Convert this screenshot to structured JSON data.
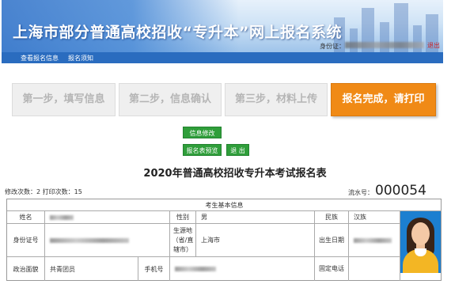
{
  "header": {
    "title": "上海市部分普通高校招收“专升本”网上报名系统",
    "id_label": "身份证：",
    "exit_label": "退出"
  },
  "nav": {
    "items": [
      "查看报名信息",
      "报名须知"
    ]
  },
  "steps": [
    {
      "label": "第一步，填写信息",
      "active": false
    },
    {
      "label": "第二步，信息确认",
      "active": false
    },
    {
      "label": "第三步，材料上传",
      "active": false
    },
    {
      "label": "报名完成，请打印",
      "active": true
    }
  ],
  "actions": {
    "modify": "信息修改",
    "preview": "报名表预览",
    "exit": "退 出"
  },
  "form": {
    "title": "2020年普通高校招收专升本考试报名表",
    "counts": "修改次数：2  打印次数：15",
    "serial_label": "流水号：",
    "serial_value": "000054",
    "section_title": "考生基本信息",
    "labels": {
      "name": "姓名",
      "gender": "性别",
      "ethnicity": "民族",
      "id_number": "身份证号",
      "origin": "生源地（省/直辖市）",
      "birth_date": "出生日期",
      "political": "政治面貌",
      "mobile": "手机号",
      "landline": "固定电话"
    },
    "values": {
      "gender": "男",
      "ethnicity": "汉族",
      "origin": "上海市",
      "political": "共青团员"
    }
  },
  "colors": {
    "banner_blue": "#2f71c8",
    "nav_blue": "#2a6cbf",
    "step_active": "#f08a16",
    "button_green": "#2f9e3a"
  }
}
